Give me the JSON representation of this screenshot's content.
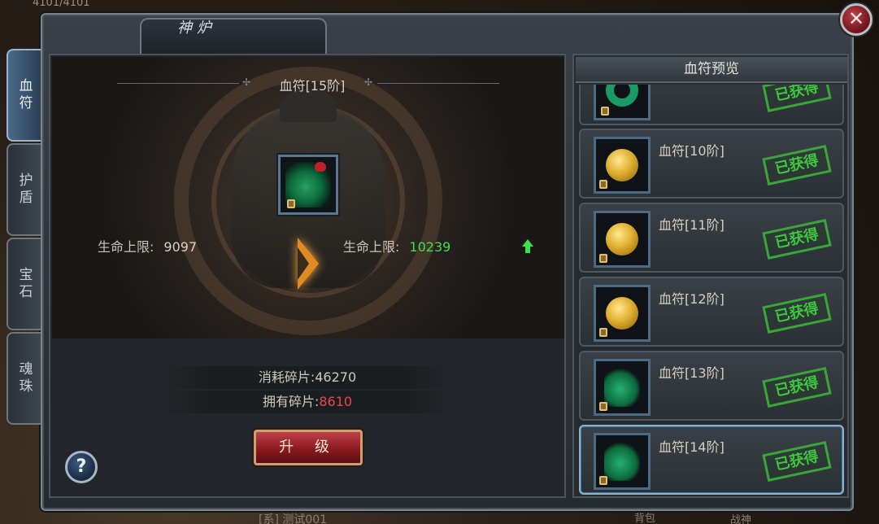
{
  "background": {
    "hp_text": "4101/4101",
    "bottom_name": "[系] 测试001",
    "bag_label": "背包",
    "war_label": "战神"
  },
  "window": {
    "title": "神炉",
    "close_glyph": "✕"
  },
  "side_tabs": [
    {
      "label": "血符",
      "active": true
    },
    {
      "label": "护盾",
      "active": false
    },
    {
      "label": "宝石",
      "active": false
    },
    {
      "label": "魂珠",
      "active": false
    }
  ],
  "main": {
    "stage_title": "血符[15阶]",
    "current_stat": {
      "label": "生命上限:",
      "value": "9097"
    },
    "next_stat": {
      "label": "生命上限:",
      "value": "10239"
    },
    "cost": {
      "label": "消耗碎片:",
      "value": "46270"
    },
    "owned": {
      "label": "拥有碎片:",
      "value": "8610"
    },
    "upgrade_label": "升 级",
    "help_label": "?"
  },
  "preview": {
    "header": "血符预览",
    "items": [
      {
        "name": "",
        "stamp": "已获得",
        "icon": "jade-ring-icon"
      },
      {
        "name": "血符[10阶]",
        "stamp": "已获得",
        "icon": "gold-coin-icon"
      },
      {
        "name": "血符[11阶]",
        "stamp": "已获得",
        "icon": "gold-coin-icon"
      },
      {
        "name": "血符[12阶]",
        "stamp": "已获得",
        "icon": "gold-coin-icon"
      },
      {
        "name": "血符[13阶]",
        "stamp": "已获得",
        "icon": "jade-pendant-icon"
      },
      {
        "name": "血符[14阶]",
        "stamp": "已获得",
        "icon": "jade-pendant-icon",
        "selected": true
      }
    ]
  },
  "colors": {
    "stat_increase": "#3ee04c",
    "insufficient": "#e8484a",
    "obtained_stamp": "#3ec83e"
  }
}
